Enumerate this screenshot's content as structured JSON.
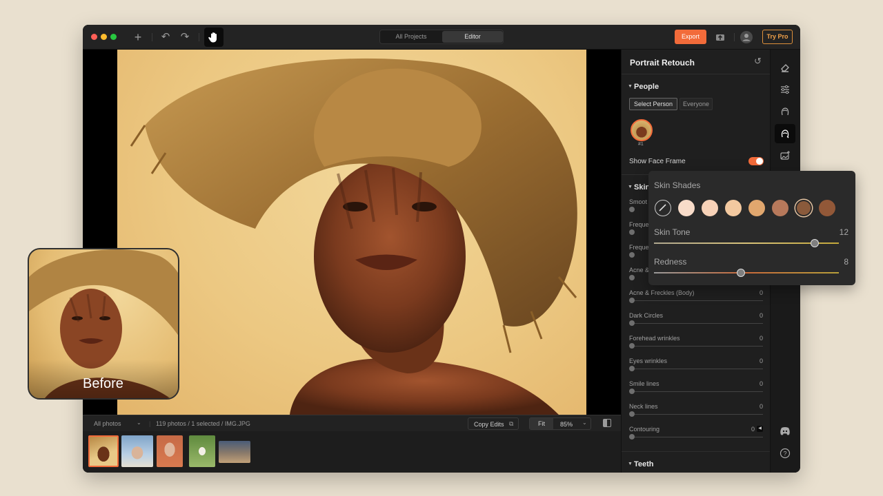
{
  "titlebar": {
    "tabs": [
      "All Projects",
      "Editor"
    ],
    "active_tab": "Editor",
    "export_label": "Export",
    "try_pro_label": "Try Pro"
  },
  "statusbar": {
    "album": "All photos",
    "info": "119 photos / 1 selected / IMG.JPG",
    "copy_edits": "Copy Edits",
    "fit": "Fit",
    "zoom": "85%"
  },
  "panel": {
    "title": "Portrait Retouch",
    "people": {
      "title": "People",
      "buttons": [
        "Select Person",
        "Everyone"
      ],
      "person_tag": "#1",
      "show_face_frame": "Show Face Frame"
    },
    "skin": {
      "title": "Skin",
      "sliders": [
        {
          "label": "Acne & Freckles (Body)",
          "value": "0"
        },
        {
          "label": "Dark Circles",
          "value": "0"
        },
        {
          "label": "Forehead wrinkles",
          "value": "0"
        },
        {
          "label": "Eyes wrinkles",
          "value": "0"
        },
        {
          "label": "Smile lines",
          "value": "0"
        },
        {
          "label": "Neck lines",
          "value": "0"
        },
        {
          "label": "Contouring",
          "value": "0"
        }
      ],
      "partial_labels": [
        "Smoot",
        "Freque",
        "Freque",
        "Acne &"
      ]
    },
    "teeth_title": "Teeth"
  },
  "popover": {
    "title": "Skin Shades",
    "swatches": [
      "#f8dcc9",
      "#f7d2b8",
      "#f3c9a0",
      "#e1a76e",
      "#b7795b",
      "#8a5a3b",
      "#925838"
    ],
    "selected_swatch": 5,
    "skin_tone_label": "Skin Tone",
    "skin_tone_value": "12",
    "skin_tone_level": 0.87,
    "redness_label": "Redness",
    "redness_value": "8",
    "redness_level": 0.47
  },
  "before_label": "Before",
  "colors": {
    "accent": "#f26b3a",
    "pro": "#f2a24a",
    "background": "#e9e0cf"
  }
}
